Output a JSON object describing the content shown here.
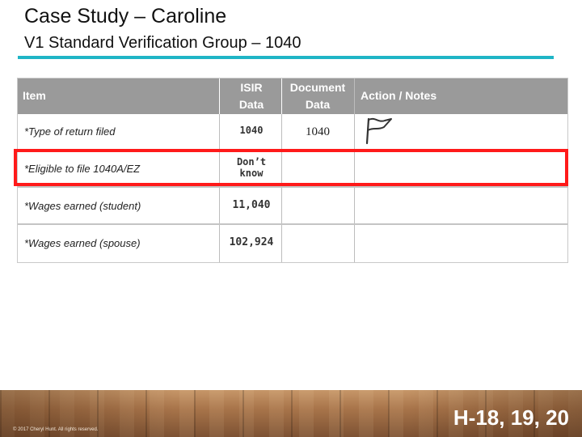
{
  "title": "Case Study – Caroline",
  "subtitle": "V1 Standard Verification Group – 1040",
  "table": {
    "headers": {
      "item": "Item",
      "isir_line1": "ISIR",
      "isir_line2": "Data",
      "doc_line1": "Document",
      "doc_line2": "Data",
      "action": "Action / Notes"
    },
    "rows": [
      {
        "item": "*Type of return filed",
        "isir": "1040",
        "document": "1040",
        "action": ""
      },
      {
        "item": "*Eligible to file 1040A/EZ",
        "isir_line1": "Don’t",
        "isir_line2": "know",
        "document": "",
        "action": ""
      },
      {
        "item": "*Wages earned (student)",
        "isir": "11,040",
        "document": "",
        "action": ""
      },
      {
        "item": "*Wages earned (spouse)",
        "isir": "102,924",
        "document": "",
        "action": ""
      }
    ]
  },
  "flag_icon": "flag-icon",
  "highlight_color": "#ff1a1a",
  "accent_color": "#1fb5c6",
  "footer": {
    "copyright": "© 2017 Cheryl Hunt. All rights reserved.",
    "slide_ref": "H-18, 19, 20"
  }
}
